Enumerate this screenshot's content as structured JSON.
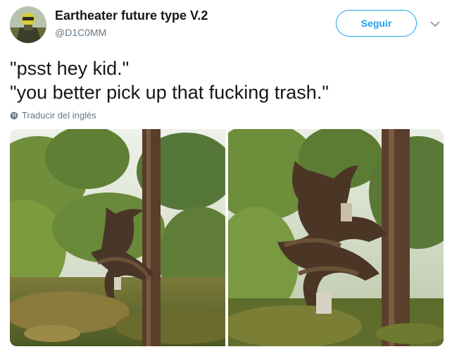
{
  "tweet": {
    "display_name": "Eartheater future type V.2",
    "handle": "@D1C0MM",
    "follow_label": "Seguir",
    "text_lines": [
      "\"psst hey kid.\"",
      "\"you better pick up that fucking trash.\""
    ],
    "translate_label": "Traducir del inglés"
  },
  "media": {
    "photo_count": 2,
    "photos": [
      {
        "subject": "tree-stump-roots-creature-left"
      },
      {
        "subject": "tree-stump-roots-creature-right"
      }
    ]
  },
  "colors": {
    "accent": "#1da1f2",
    "text": "#14171a",
    "secondary_text": "#657786"
  },
  "icons": [
    "avatar",
    "chevron-down-icon",
    "globe-icon"
  ]
}
